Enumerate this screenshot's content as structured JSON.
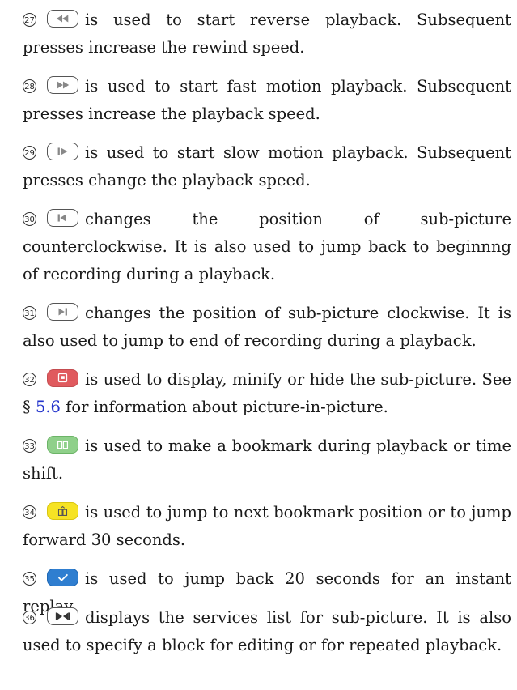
{
  "items": [
    {
      "num": "27",
      "icon": "rewind-icon",
      "text": "is used to start reverse playback. Subsequent presses increase the rewind speed."
    },
    {
      "num": "28",
      "icon": "fast-forward-icon",
      "text": "is used to start fast motion playback. Subsequent presses increase the playback speed."
    },
    {
      "num": "29",
      "icon": "slow-motion-icon",
      "text": "is used to start slow motion playback. Subsequent presses change the playback speed."
    },
    {
      "num": "30",
      "icon": "skip-back-icon",
      "text": "changes the position of sub-picture counterclockwise. It is also used to jump back to beginnng of recording during a playback."
    },
    {
      "num": "31",
      "icon": "skip-forward-icon",
      "text": "changes the position of sub-picture clockwise. It is also used to jump to end of recording during a playback."
    },
    {
      "num": "32",
      "icon": "red-button-icon",
      "text_before": "is used to display, minify or hide the sub-picture. See § ",
      "link": "5.6",
      "text_after": " for information about picture-in-picture."
    },
    {
      "num": "33",
      "icon": "green-bookmark-icon",
      "text": "is used to make a bookmark during playback or time shift."
    },
    {
      "num": "34",
      "icon": "yellow-bookmark-icon",
      "text": "is used to jump to next bookmark position or to jump forward 30 seconds."
    },
    {
      "num": "35",
      "icon": "blue-check-icon",
      "text": "is used to jump back 20 seconds for an instant replay."
    },
    {
      "num": "36",
      "icon": "block-edit-icon",
      "text": "displays the services list for sub-picture. It is also used to specify a block for editing or for repeated playback."
    }
  ],
  "colors": {
    "red": "#e05a5e",
    "green": "#8fd08a",
    "yellow": "#f6e324",
    "blue": "#2f7ed0",
    "link": "#2233cc"
  }
}
